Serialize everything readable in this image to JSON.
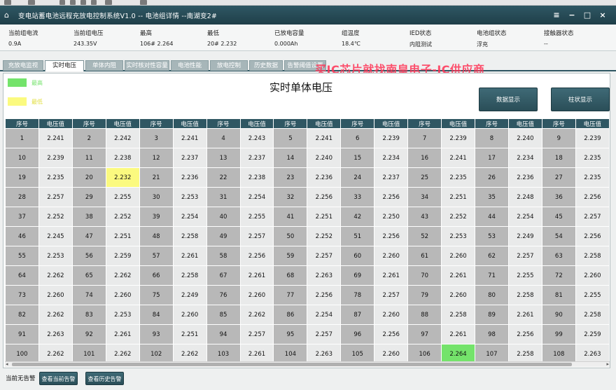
{
  "window": {
    "title": "变电站蓄电池远程充放电控制系统V1.0 -- 电池组详情 --南湖变2#"
  },
  "info": [
    {
      "label": "当前组电流",
      "value": "0.9A"
    },
    {
      "label": "当前组电压",
      "value": "243.35V"
    },
    {
      "label": "最高",
      "value": "106# 2.264"
    },
    {
      "label": "最低",
      "value": "20# 2.232"
    },
    {
      "label": "已放电容量",
      "value": "0.000Ah"
    },
    {
      "label": "组温度",
      "value": "18.4℃"
    },
    {
      "label": "IED状态",
      "value": "内阻测试"
    },
    {
      "label": "电池组状态",
      "value": "浮充"
    },
    {
      "label": "接触器状态",
      "value": "--"
    }
  ],
  "tabs": [
    "充放电监视",
    "实时电压",
    "单体内阻",
    "实时核对性容量",
    "电池性能",
    "放电控制",
    "历史数据",
    "告警阈值设置"
  ],
  "watermark": "买IC芯片就找南皇电子-IC供应商",
  "legend": {
    "high_label": "最高",
    "low_label": "最低",
    "high_color": "#74e36b",
    "low_color": "#fbfa7f"
  },
  "page_title": "实时单体电压",
  "buttons": {
    "data_display": "数据显示",
    "bar_display": "柱状显示"
  },
  "grid": {
    "header": {
      "index": "序号",
      "value": "电压值"
    },
    "rows": [
      [
        [
          1,
          "2.241"
        ],
        [
          2,
          "2.242"
        ],
        [
          3,
          "2.241"
        ],
        [
          4,
          "2.243"
        ],
        [
          5,
          "2.241"
        ],
        [
          6,
          "2.239"
        ],
        [
          7,
          "2.239"
        ],
        [
          8,
          "2.240"
        ],
        [
          9,
          "2.239"
        ]
      ],
      [
        [
          10,
          "2.239"
        ],
        [
          11,
          "2.238"
        ],
        [
          12,
          "2.237"
        ],
        [
          13,
          "2.237"
        ],
        [
          14,
          "2.240"
        ],
        [
          15,
          "2.234"
        ],
        [
          16,
          "2.241"
        ],
        [
          17,
          "2.234"
        ],
        [
          18,
          "2.235"
        ]
      ],
      [
        [
          19,
          "2.235"
        ],
        [
          20,
          "2.232"
        ],
        [
          21,
          "2.236"
        ],
        [
          22,
          "2.238"
        ],
        [
          23,
          "2.236"
        ],
        [
          24,
          "2.237"
        ],
        [
          25,
          "2.235"
        ],
        [
          26,
          "2.236"
        ],
        [
          27,
          "2.235"
        ]
      ],
      [
        [
          28,
          "2.257"
        ],
        [
          29,
          "2.255"
        ],
        [
          30,
          "2.253"
        ],
        [
          31,
          "2.254"
        ],
        [
          32,
          "2.256"
        ],
        [
          33,
          "2.256"
        ],
        [
          34,
          "2.251"
        ],
        [
          35,
          "2.248"
        ],
        [
          36,
          "2.256"
        ]
      ],
      [
        [
          37,
          "2.252"
        ],
        [
          38,
          "2.252"
        ],
        [
          39,
          "2.254"
        ],
        [
          40,
          "2.255"
        ],
        [
          41,
          "2.251"
        ],
        [
          42,
          "2.250"
        ],
        [
          43,
          "2.252"
        ],
        [
          44,
          "2.254"
        ],
        [
          45,
          "2.257"
        ]
      ],
      [
        [
          46,
          "2.245"
        ],
        [
          47,
          "2.251"
        ],
        [
          48,
          "2.258"
        ],
        [
          49,
          "2.257"
        ],
        [
          50,
          "2.252"
        ],
        [
          51,
          "2.256"
        ],
        [
          52,
          "2.253"
        ],
        [
          53,
          "2.249"
        ],
        [
          54,
          "2.256"
        ]
      ],
      [
        [
          55,
          "2.253"
        ],
        [
          56,
          "2.259"
        ],
        [
          57,
          "2.261"
        ],
        [
          58,
          "2.256"
        ],
        [
          59,
          "2.257"
        ],
        [
          60,
          "2.260"
        ],
        [
          61,
          "2.260"
        ],
        [
          62,
          "2.257"
        ],
        [
          63,
          "2.258"
        ]
      ],
      [
        [
          64,
          "2.262"
        ],
        [
          65,
          "2.262"
        ],
        [
          66,
          "2.258"
        ],
        [
          67,
          "2.261"
        ],
        [
          68,
          "2.263"
        ],
        [
          69,
          "2.261"
        ],
        [
          70,
          "2.261"
        ],
        [
          71,
          "2.255"
        ],
        [
          72,
          "2.260"
        ]
      ],
      [
        [
          73,
          "2.260"
        ],
        [
          74,
          "2.260"
        ],
        [
          75,
          "2.249"
        ],
        [
          76,
          "2.260"
        ],
        [
          77,
          "2.256"
        ],
        [
          78,
          "2.257"
        ],
        [
          79,
          "2.260"
        ],
        [
          80,
          "2.258"
        ],
        [
          81,
          "2.255"
        ]
      ],
      [
        [
          82,
          "2.262"
        ],
        [
          83,
          "2.253"
        ],
        [
          84,
          "2.260"
        ],
        [
          85,
          "2.262"
        ],
        [
          86,
          "2.254"
        ],
        [
          87,
          "2.260"
        ],
        [
          88,
          "2.258"
        ],
        [
          89,
          "2.261"
        ],
        [
          90,
          "2.258"
        ]
      ],
      [
        [
          91,
          "2.263"
        ],
        [
          92,
          "2.261"
        ],
        [
          93,
          "2.251"
        ],
        [
          94,
          "2.257"
        ],
        [
          95,
          "2.257"
        ],
        [
          96,
          "2.256"
        ],
        [
          97,
          "2.261"
        ],
        [
          98,
          "2.256"
        ],
        [
          99,
          "2.259"
        ]
      ],
      [
        [
          100,
          "2.262"
        ],
        [
          101,
          "2.262"
        ],
        [
          102,
          "2.262"
        ],
        [
          103,
          "2.261"
        ],
        [
          104,
          "2.263"
        ],
        [
          105,
          "2.260"
        ],
        [
          106,
          "2.264"
        ],
        [
          107,
          "2.258"
        ],
        [
          108,
          "2.263"
        ]
      ]
    ],
    "highest_index": 106,
    "lowest_index": 20
  },
  "alarm": {
    "status_text": "当前无告警",
    "view_current": "查看当前告警",
    "view_history": "查看历史告警"
  }
}
